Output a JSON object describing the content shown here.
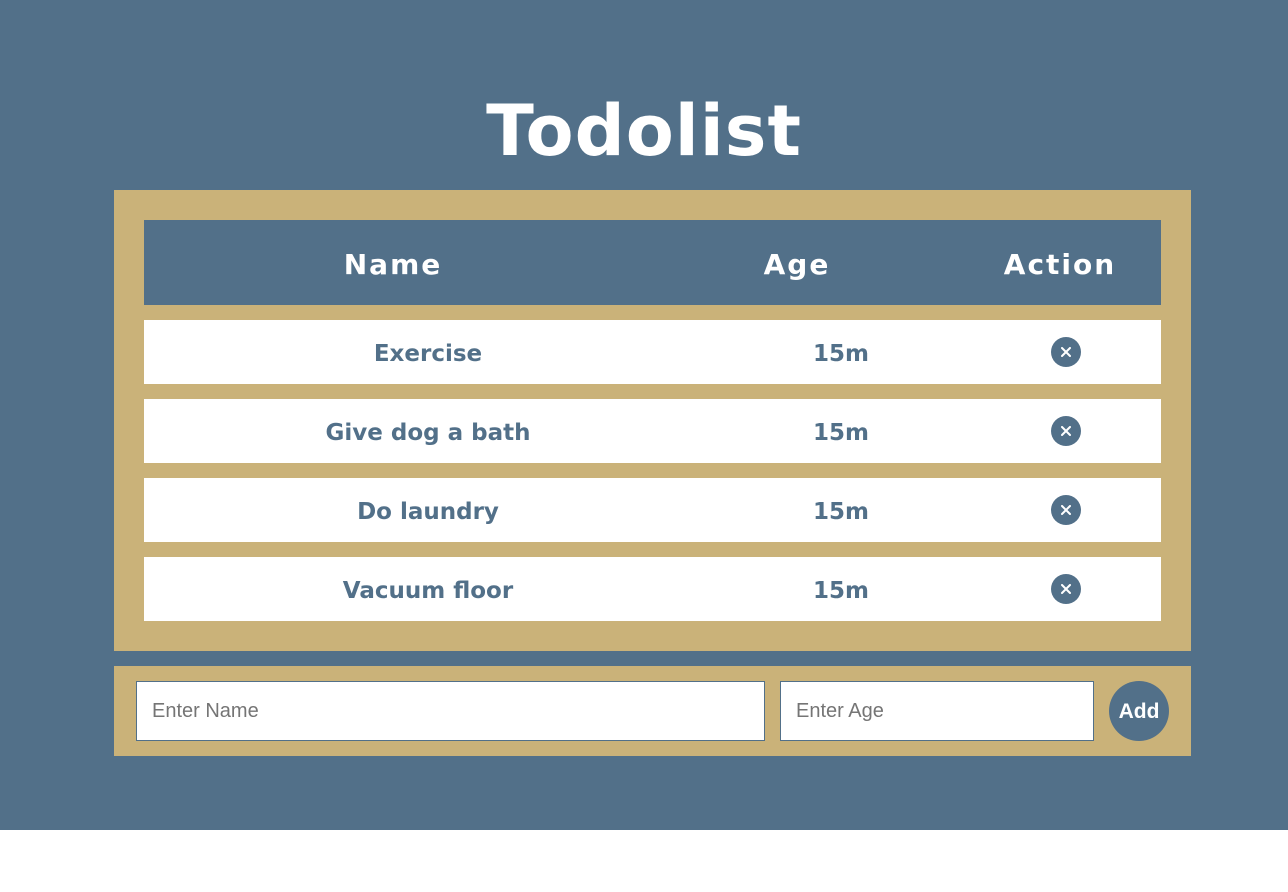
{
  "title": "Todolist",
  "table": {
    "columns": [
      "Name",
      "Age",
      "Action"
    ],
    "rows": [
      {
        "name": "Exercise",
        "age": "15m",
        "action_icon": "close-icon"
      },
      {
        "name": "Give dog a bath",
        "age": "15m",
        "action_icon": "close-icon"
      },
      {
        "name": "Do laundry",
        "age": "15m",
        "action_icon": "close-icon"
      },
      {
        "name": "Vacuum floor",
        "age": "15m",
        "action_icon": "close-icon"
      }
    ]
  },
  "form": {
    "name_placeholder": "Enter Name",
    "name_value": "",
    "age_placeholder": "Enter Age",
    "age_value": "",
    "add_label": "Add"
  },
  "colors": {
    "primary": "#527089",
    "panel": "#cab279",
    "surface": "#ffffff"
  }
}
